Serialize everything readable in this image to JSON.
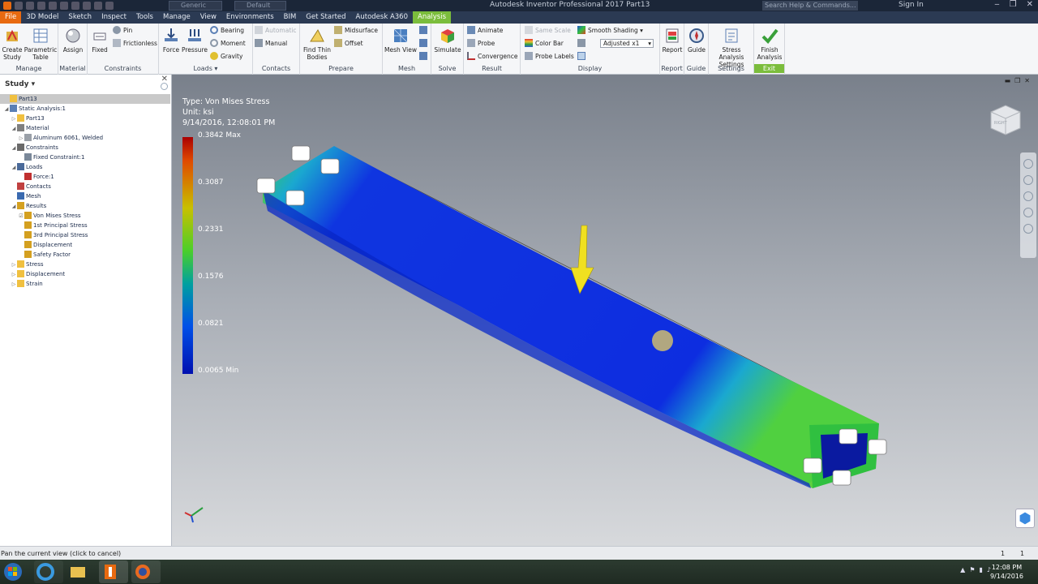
{
  "window": {
    "title": "Autodesk Inventor Professional 2017    Part13",
    "material_combo": "Generic",
    "appearance_combo": "Default",
    "search_placeholder": "Search Help & Commands...",
    "sign_in": "Sign In",
    "min": "‒",
    "restore": "❐",
    "close": "✕"
  },
  "tabs": [
    "File",
    "3D Model",
    "Sketch",
    "Inspect",
    "Tools",
    "Manage",
    "View",
    "Environments",
    "BIM",
    "Get Started",
    "Autodesk A360",
    "Analysis"
  ],
  "ribbon": {
    "manage": {
      "title": "Manage",
      "create_study": "Create Study",
      "parametric_table": "Parametric Table"
    },
    "material": {
      "title": "Material",
      "assign": "Assign"
    },
    "constraints": {
      "title": "Constraints",
      "fixed": "Fixed",
      "pin": "Pin",
      "frictionless": "Frictionless"
    },
    "loads": {
      "title": "Loads ▾",
      "force": "Force",
      "pressure": "Pressure",
      "bearing": "Bearing",
      "moment": "Moment",
      "gravity": "Gravity"
    },
    "contacts": {
      "title": "Contacts",
      "automatic": "Automatic",
      "manual": "Manual"
    },
    "prepare": {
      "title": "Prepare",
      "find_thin_bodies": "Find Thin Bodies",
      "midsurface": "Midsurface",
      "offset": "Offset"
    },
    "mesh": {
      "title": "Mesh",
      "mesh_view": "Mesh View"
    },
    "solve": {
      "title": "Solve",
      "simulate": "Simulate"
    },
    "result": {
      "title": "Result",
      "animate": "Animate",
      "probe": "Probe",
      "convergence": "Convergence"
    },
    "display": {
      "title": "Display",
      "same_scale": "Same Scale",
      "color_bar": "Color Bar",
      "probe_labels": "Probe Labels",
      "shading": "Smooth Shading",
      "adjusted": "Adjusted x1"
    },
    "report": {
      "title": "Report",
      "report": "Report"
    },
    "guide": {
      "title": "Guide",
      "guide": "Guide"
    },
    "settings": {
      "title": "Settings",
      "stress_analysis_settings": "Stress Analysis Settings"
    },
    "exit": {
      "title": "Exit",
      "finish_analysis": "Finish Analysis"
    }
  },
  "browser": {
    "title": "Study ▾",
    "items": [
      {
        "label": "Part13",
        "level": 0,
        "exp": "",
        "icon": "#f0c040",
        "selected": true
      },
      {
        "label": "Static Analysis:1",
        "level": 0,
        "exp": "◢",
        "icon": "#5a7fb5"
      },
      {
        "label": "Part13",
        "level": 1,
        "exp": "▷",
        "icon": "#f0c040"
      },
      {
        "label": "Material",
        "level": 1,
        "exp": "◢",
        "icon": "#808080"
      },
      {
        "label": "Aluminum 6061, Welded",
        "level": 2,
        "exp": "▷",
        "icon": "#9aa0a8"
      },
      {
        "label": "Constraints",
        "level": 1,
        "exp": "◢",
        "icon": "#6a6a6a"
      },
      {
        "label": "Fixed Constraint:1",
        "level": 2,
        "exp": "",
        "icon": "#7a8899"
      },
      {
        "label": "Loads",
        "level": 1,
        "exp": "◢",
        "icon": "#4a6a9a"
      },
      {
        "label": "Force:1",
        "level": 2,
        "exp": "",
        "icon": "#c03030"
      },
      {
        "label": "Contacts",
        "level": 1,
        "exp": "",
        "icon": "#c04040"
      },
      {
        "label": "Mesh",
        "level": 1,
        "exp": "",
        "icon": "#3a6ab0"
      },
      {
        "label": "Results",
        "level": 1,
        "exp": "◢",
        "icon": "#d4a020"
      },
      {
        "label": "Von Mises Stress",
        "level": 2,
        "exp": "☑",
        "icon": "#d4a020"
      },
      {
        "label": "1st Principal Stress",
        "level": 2,
        "exp": "",
        "icon": "#d4a020"
      },
      {
        "label": "3rd Principal Stress",
        "level": 2,
        "exp": "",
        "icon": "#d4a020"
      },
      {
        "label": "Displacement",
        "level": 2,
        "exp": "",
        "icon": "#d4a020"
      },
      {
        "label": "Safety Factor",
        "level": 2,
        "exp": "",
        "icon": "#d4a020"
      },
      {
        "label": "Stress",
        "level": 1,
        "exp": "▷",
        "icon": "#f0c040"
      },
      {
        "label": "Displacement",
        "level": 1,
        "exp": "▷",
        "icon": "#f0c040"
      },
      {
        "label": "Strain",
        "level": 1,
        "exp": "▷",
        "icon": "#f0c040"
      }
    ]
  },
  "viewport": {
    "type_line": "Type: Von Mises Stress",
    "unit_line": "Unit: ksi",
    "date_line": "9/14/2016, 12:08:01 PM",
    "colorbar_labels": [
      "0.3842 Max",
      "0.3087",
      "0.2331",
      "0.1576",
      "0.0821",
      "0.0065 Min"
    ],
    "viewcube_text": "RIGHT"
  },
  "statusbar": {
    "message": "Pan the current view (click to cancel)",
    "count1": "1",
    "count2": "1"
  },
  "taskbar": {
    "time": "12:08 PM",
    "date": "9/14/2016"
  }
}
